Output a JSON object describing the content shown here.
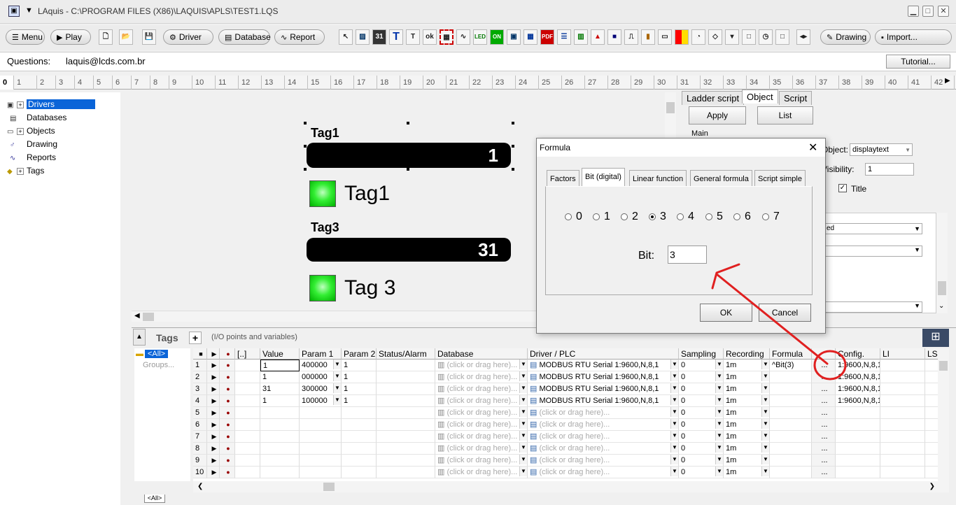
{
  "window": {
    "title": "LAquis - C:\\PROGRAM FILES (X86)\\LAQUIS\\APLS\\TEST1.LQS",
    "min": "▁",
    "max": "□",
    "close": "✕"
  },
  "toolbar": {
    "menu": "Menu",
    "play": "Play",
    "driver": "Driver",
    "database": "Database",
    "report": "Report",
    "drawing": "Drawing",
    "import": "Import..."
  },
  "questions": {
    "label": "Questions:",
    "email": "laquis@lcds.com.br",
    "tutorial": "Tutorial..."
  },
  "ruler": {
    "ticks": [
      "0",
      "1",
      "2",
      "3",
      "4",
      "5",
      "6",
      "7",
      "8",
      "9",
      "10",
      "11",
      "12",
      "13",
      "14",
      "15",
      "16",
      "17",
      "18",
      "19",
      "20",
      "21",
      "22",
      "23",
      "24",
      "25",
      "26",
      "27",
      "28",
      "29",
      "30",
      "31",
      "32",
      "33",
      "34",
      "35",
      "36",
      "37",
      "38",
      "39",
      "40",
      "41",
      "42"
    ]
  },
  "tree": {
    "items": [
      {
        "label": "Drivers",
        "icon": "drivers-icon"
      },
      {
        "label": "Databases",
        "icon": "database-icon"
      },
      {
        "label": "Objects",
        "icon": "objects-icon"
      },
      {
        "label": "Drawing",
        "icon": "drawing-icon"
      },
      {
        "label": "Reports",
        "icon": "reports-icon"
      },
      {
        "label": "Tags",
        "icon": "tags-icon"
      }
    ]
  },
  "canvas": {
    "tag1_title": "Tag1",
    "tag1_value": "1",
    "led1_label": "Tag1",
    "tag3_title": "Tag3",
    "tag3_value": "31",
    "led3_label": "Tag 3"
  },
  "props": {
    "tabs": [
      "Ladder script",
      "Object",
      "Script"
    ],
    "apply": "Apply",
    "list": "List",
    "main": "Main",
    "object_label": "Object:",
    "object_value": "displaytext",
    "visibility_label": "Visibility:",
    "visibility_value": "1",
    "title_label": "Title",
    "combo_text": "ed"
  },
  "dialog": {
    "title": "Formula",
    "tabs": [
      "Factors",
      "Bit (digital)",
      "Linear function",
      "General formula",
      "Script simple"
    ],
    "bits": [
      "0",
      "1",
      "2",
      "3",
      "4",
      "5",
      "6",
      "7"
    ],
    "bit_label": "Bit:",
    "bit_value": "3",
    "ok": "OK",
    "cancel": "Cancel"
  },
  "tags": {
    "title": "Tags",
    "plus": "+",
    "subtitle": "(I/O points and variables)",
    "all": "<All>",
    "groups": "Groups...",
    "bottom_tab": "<All>",
    "headers": [
      "",
      "",
      "",
      "[..]",
      "Value",
      "Param 1",
      "Param 2",
      "Status/Alarm",
      "Database",
      "Driver / PLC",
      "Sampling",
      "Recording",
      "Formula",
      "",
      "Config.",
      "LI",
      "LS"
    ],
    "rows": [
      {
        "n": "1",
        "value": "1",
        "p1": "400000",
        "p2": "1",
        "db": "(click or drag here)...",
        "drv": "MODBUS RTU Serial 1:9600,N,8,1",
        "samp": "0",
        "rec": "1m",
        "formula": "^Bit(3)",
        "cfg": "1:9600,N,8,1"
      },
      {
        "n": "2",
        "value": "1",
        "p1": "000000",
        "p2": "1",
        "db": "(click or drag here)...",
        "drv": "MODBUS RTU Serial 1:9600,N,8,1",
        "samp": "0",
        "rec": "1m",
        "formula": "",
        "cfg": "1:9600,N,8,1"
      },
      {
        "n": "3",
        "value": "31",
        "p1": "300000",
        "p2": "1",
        "db": "(click or drag here)...",
        "drv": "MODBUS RTU Serial 1:9600,N,8,1",
        "samp": "0",
        "rec": "1m",
        "formula": "",
        "cfg": "1:9600,N,8,1"
      },
      {
        "n": "4",
        "value": "1",
        "p1": "100000",
        "p2": "1",
        "db": "(click or drag here)...",
        "drv": "MODBUS RTU Serial 1:9600,N,8,1",
        "samp": "0",
        "rec": "1m",
        "formula": "",
        "cfg": "1:9600,N,8,1"
      },
      {
        "n": "5",
        "value": "",
        "p1": "",
        "p2": "",
        "db": "(click or drag here)...",
        "drv": "(click or drag here)...",
        "samp": "0",
        "rec": "1m",
        "formula": "",
        "cfg": ""
      },
      {
        "n": "6",
        "value": "",
        "p1": "",
        "p2": "",
        "db": "(click or drag here)...",
        "drv": "(click or drag here)...",
        "samp": "0",
        "rec": "1m",
        "formula": "",
        "cfg": ""
      },
      {
        "n": "7",
        "value": "",
        "p1": "",
        "p2": "",
        "db": "(click or drag here)...",
        "drv": "(click or drag here)...",
        "samp": "0",
        "rec": "1m",
        "formula": "",
        "cfg": ""
      },
      {
        "n": "8",
        "value": "",
        "p1": "",
        "p2": "",
        "db": "(click or drag here)...",
        "drv": "(click or drag here)...",
        "samp": "0",
        "rec": "1m",
        "formula": "",
        "cfg": ""
      },
      {
        "n": "9",
        "value": "",
        "p1": "",
        "p2": "",
        "db": "(click or drag here)...",
        "drv": "(click or drag here)...",
        "samp": "0",
        "rec": "1m",
        "formula": "",
        "cfg": ""
      },
      {
        "n": "10",
        "value": "",
        "p1": "",
        "p2": "",
        "db": "(click or drag here)...",
        "drv": "(click or drag here)...",
        "samp": "0",
        "rec": "1m",
        "formula": "",
        "cfg": ""
      }
    ]
  },
  "colors": {
    "annotation": "#e02020",
    "selection": "#0a64d8",
    "led": "#33ee33"
  }
}
